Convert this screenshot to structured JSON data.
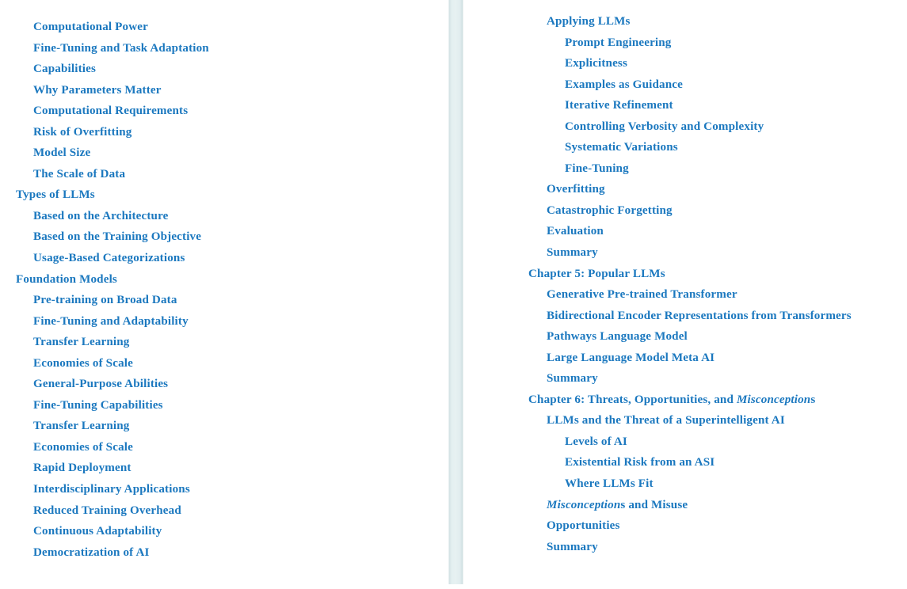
{
  "document": {
    "kind": "table-of-contents",
    "accent_color": "#1b78bf",
    "background_color": "#ffffff",
    "divider_color": "#e3eff0"
  },
  "columns": [
    {
      "id": "left",
      "entries": [
        {
          "label": "Computational Power",
          "level": 2
        },
        {
          "label": "Fine-Tuning and Task Adaptation",
          "level": 2
        },
        {
          "label": "Capabilities",
          "level": 2
        },
        {
          "label": "Why Parameters Matter",
          "level": 2
        },
        {
          "label": "Computational Requirements",
          "level": 2
        },
        {
          "label": "Risk of Overfitting",
          "level": 2
        },
        {
          "label": "Model Size",
          "level": 2
        },
        {
          "label": "The Scale of Data",
          "level": 2
        },
        {
          "label": "Types of LLMs",
          "level": 1
        },
        {
          "label": "Based on the Architecture",
          "level": 2
        },
        {
          "label": "Based on the Training Objective",
          "level": 2
        },
        {
          "label": "Usage-Based Categorizations",
          "level": 2
        },
        {
          "label": "Foundation Models",
          "level": 1
        },
        {
          "label": "Pre-training on Broad Data",
          "level": 2
        },
        {
          "label": "Fine-Tuning and Adaptability",
          "level": 2
        },
        {
          "label": "Transfer Learning",
          "level": 2
        },
        {
          "label": "Economies of Scale",
          "level": 2
        },
        {
          "label": "General-Purpose Abilities",
          "level": 2
        },
        {
          "label": "Fine-Tuning Capabilities",
          "level": 2
        },
        {
          "label": "Transfer Learning",
          "level": 2
        },
        {
          "label": "Economies of Scale",
          "level": 2
        },
        {
          "label": "Rapid Deployment",
          "level": 2
        },
        {
          "label": "Interdisciplinary Applications",
          "level": 2
        },
        {
          "label": "Reduced Training Overhead",
          "level": 2
        },
        {
          "label": "Continuous Adaptability",
          "level": 2
        },
        {
          "label": "Democratization of AI",
          "level": 2
        }
      ]
    },
    {
      "id": "right",
      "entries": [
        {
          "label": "Applying LLMs",
          "level": 2
        },
        {
          "label": "Prompt Engineering",
          "level": 3
        },
        {
          "label": "Explicitness",
          "level": 3
        },
        {
          "label": "Examples as Guidance",
          "level": 3
        },
        {
          "label": "Iterative Refinement",
          "level": 3
        },
        {
          "label": "Controlling Verbosity and Complexity",
          "level": 3
        },
        {
          "label": "Systematic Variations",
          "level": 3
        },
        {
          "label": "Fine-Tuning",
          "level": 3
        },
        {
          "label": "Overfitting",
          "level": 2
        },
        {
          "label": "Catastrophic Forgetting",
          "level": 2
        },
        {
          "label": "Evaluation",
          "level": 2
        },
        {
          "label": "Summary",
          "level": 2
        },
        {
          "label": "Chapter 5: Popular LLMs",
          "level": 1
        },
        {
          "label": "Generative Pre-trained Transformer",
          "level": 2
        },
        {
          "label": "Bidirectional Encoder Representations from Transformers",
          "level": 2
        },
        {
          "label": "Pathways Language Model",
          "level": 2
        },
        {
          "label": "Large Language Model Meta AI",
          "level": 2
        },
        {
          "label": "Summary",
          "level": 2
        },
        {
          "label": "Chapter 6: Threats, Opportunities, and Misconceptions",
          "level": 1,
          "italic_run": {
            "text": "Misconception",
            "prefix": "Chapter 6: Threats, Opportunities, and ",
            "suffix": "s"
          }
        },
        {
          "label": "LLMs and the Threat of a Superintelligent AI",
          "level": 2
        },
        {
          "label": "Levels of AI",
          "level": 3
        },
        {
          "label": "Existential Risk from an ASI",
          "level": 3
        },
        {
          "label": "Where LLMs Fit",
          "level": 3
        },
        {
          "label": "Misconceptions and Misuse",
          "level": 2,
          "italic_run": {
            "text": "Misconception",
            "prefix": "",
            "suffix": "s and Misuse"
          }
        },
        {
          "label": "Opportunities",
          "level": 2
        },
        {
          "label": "Summary",
          "level": 2
        }
      ]
    }
  ]
}
